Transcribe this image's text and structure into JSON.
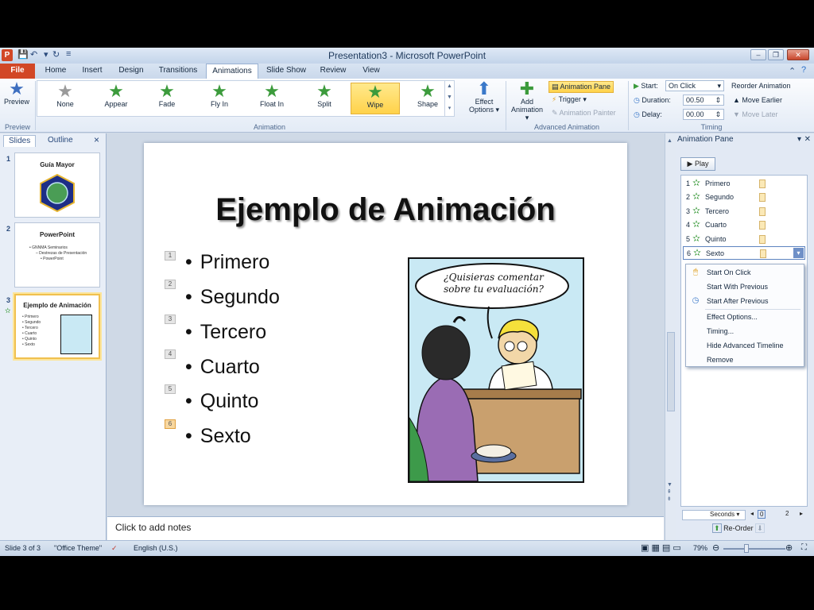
{
  "window": {
    "title": "Presentation3 - Microsoft PowerPoint"
  },
  "tabs": [
    "Home",
    "Insert",
    "Design",
    "Transitions",
    "Animations",
    "Slide Show",
    "Review",
    "View"
  ],
  "file_tab": "File",
  "ribbon": {
    "preview": "Preview",
    "preview_group": "Preview",
    "effects": [
      "None",
      "Appear",
      "Fade",
      "Fly In",
      "Float In",
      "Split",
      "Wipe",
      "Shape"
    ],
    "effect_options": [
      "Effect",
      "Options"
    ],
    "animation_group": "Animation",
    "add_animation": [
      "Add",
      "Animation"
    ],
    "animation_pane": "Animation Pane",
    "trigger": "Trigger",
    "animation_painter": "Animation Painter",
    "advanced_group": "Advanced Animation",
    "start_label": "Start:",
    "start_value": "On Click",
    "duration_label": "Duration:",
    "duration_value": "00.50",
    "delay_label": "Delay:",
    "delay_value": "00.00",
    "timing_group": "Timing",
    "reorder": "Reorder Animation",
    "move_earlier": "Move Earlier",
    "move_later": "Move Later"
  },
  "leftpane": {
    "tab_slides": "Slides",
    "tab_outline": "Outline",
    "close": "×",
    "thumbs": [
      {
        "num": "1",
        "title": "Guía Mayor"
      },
      {
        "num": "2",
        "title": "PowerPoint",
        "lines": [
          "• GNNMA Seminarios",
          "– Destrezas de Presentación",
          "• PowerPoint"
        ]
      },
      {
        "num": "3",
        "title": "Ejemplo de Animación",
        "lines": [
          "• Primero",
          "• Segundo",
          "• Tercero",
          "• Cuarto",
          "• Quinto",
          "• Sexto"
        ]
      }
    ]
  },
  "slide": {
    "title": "Ejemplo de Animación",
    "bullets": [
      {
        "num": "1",
        "text": "Primero"
      },
      {
        "num": "2",
        "text": "Segundo"
      },
      {
        "num": "3",
        "text": "Tercero"
      },
      {
        "num": "4",
        "text": "Cuarto"
      },
      {
        "num": "5",
        "text": "Quinto"
      },
      {
        "num": "6",
        "text": "Sexto"
      }
    ],
    "comic_text": [
      "¿Quisieras comentar",
      "sobre tu evaluación?"
    ]
  },
  "notes": "Click to add notes",
  "anpane": {
    "title": "Animation Pane",
    "play": "Play",
    "items": [
      {
        "num": "1",
        "label": "Primero"
      },
      {
        "num": "2",
        "label": "Segundo"
      },
      {
        "num": "3",
        "label": "Tercero"
      },
      {
        "num": "4",
        "label": "Cuarto"
      },
      {
        "num": "5",
        "label": "Quinto"
      },
      {
        "num": "6",
        "label": "Sexto"
      }
    ],
    "menu": [
      "Start On Click",
      "Start With Previous",
      "Start After Previous",
      "Effect Options...",
      "Timing...",
      "Hide Advanced Timeline",
      "Remove"
    ],
    "seconds": "Seconds",
    "timeline_start": "0",
    "timeline_end": "2",
    "reorder": "Re-Order"
  },
  "status": {
    "slide": "Slide 3 of 3",
    "theme": "\"Office Theme\"",
    "language": "English (U.S.)",
    "zoom": "79%"
  },
  "colors": {
    "file_tab": "#d24726",
    "accent_star": "#3c9b3c",
    "selected_effect": "#ffd24a"
  }
}
